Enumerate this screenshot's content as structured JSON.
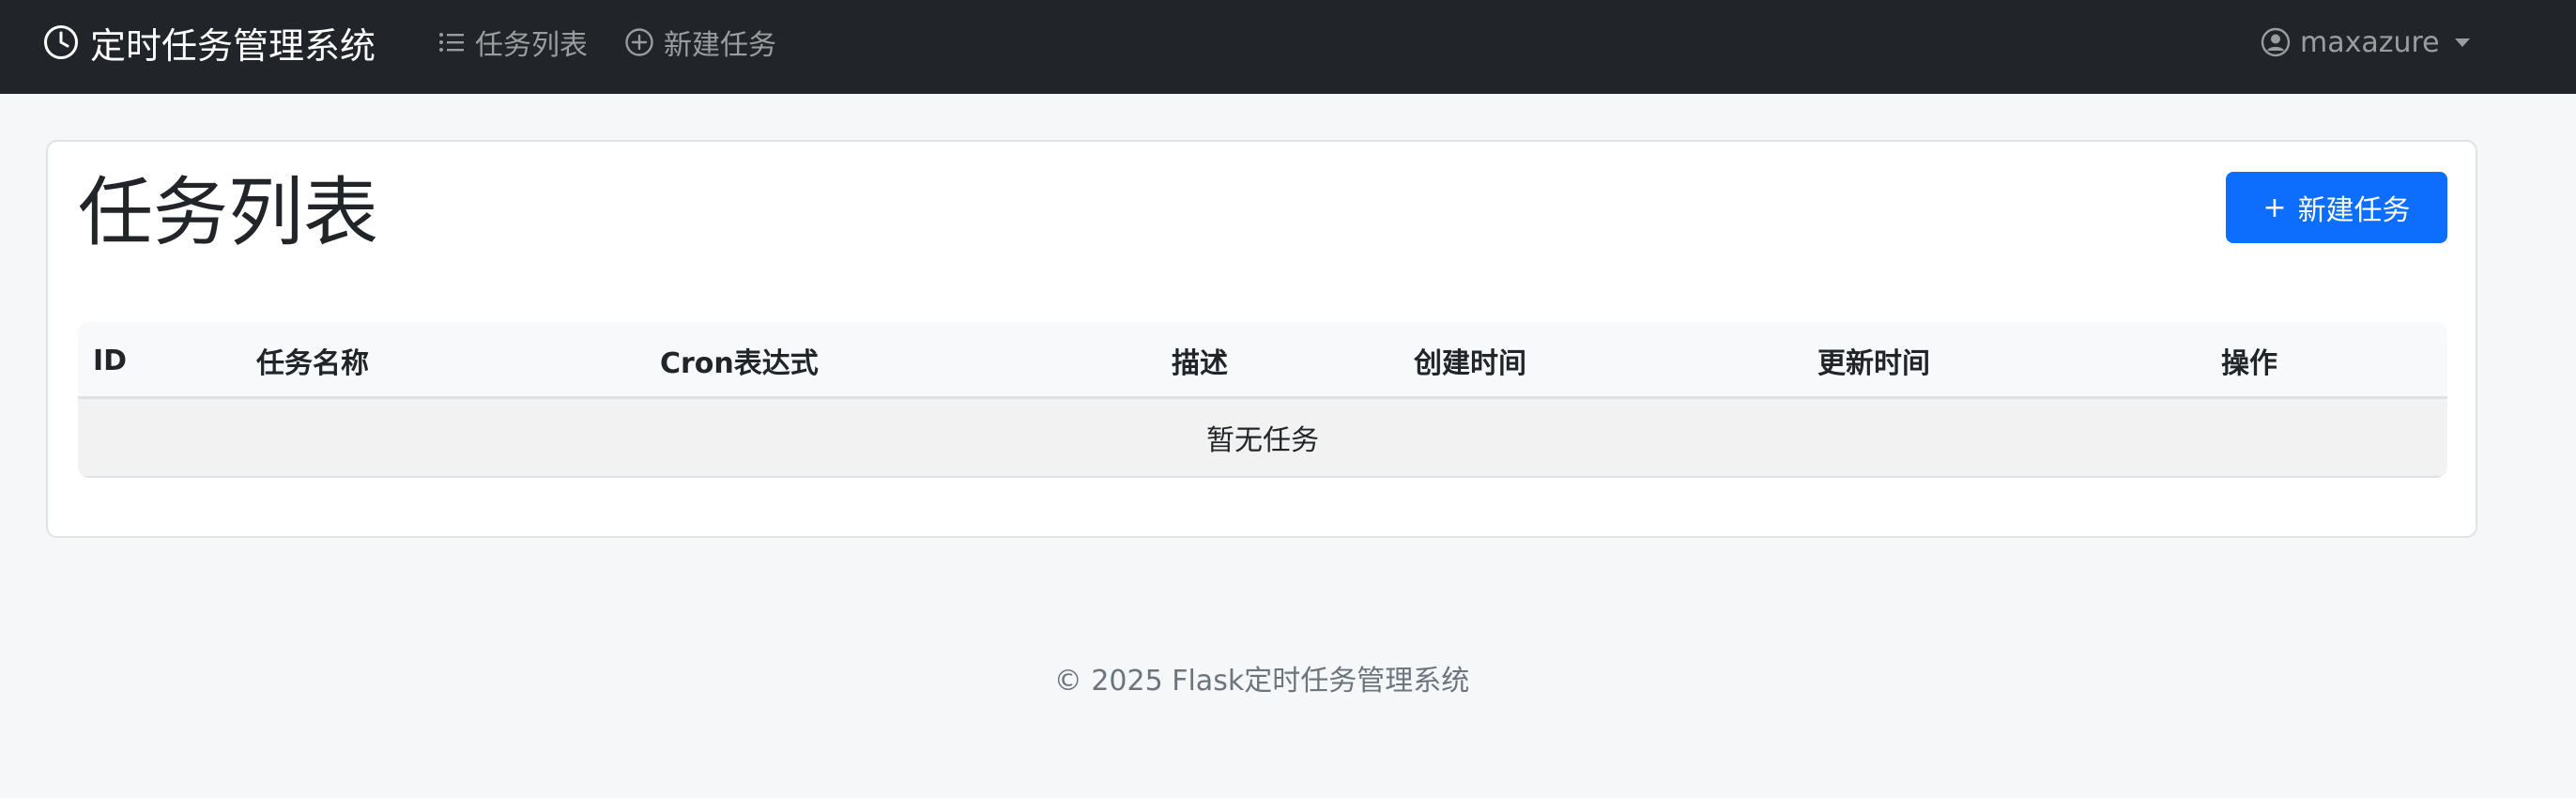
{
  "navbar": {
    "brand": "定时任务管理系统",
    "links": [
      {
        "label": "任务列表",
        "icon": "list-icon"
      },
      {
        "label": "新建任务",
        "icon": "plus-circle-icon"
      }
    ],
    "user": {
      "name": "maxazure",
      "icon": "user-circle-icon"
    }
  },
  "main": {
    "title": "任务列表",
    "new_button": {
      "icon": "plus-icon",
      "label": "新建任务"
    },
    "table": {
      "columns": [
        "ID",
        "任务名称",
        "Cron表达式",
        "描述",
        "创建时间",
        "更新时间",
        "操作"
      ],
      "empty_message": "暂无任务"
    }
  },
  "footer": {
    "text": "© 2025 Flask定时任务管理系统"
  },
  "colors": {
    "navbar_bg": "#212529",
    "primary": "#0d6efd",
    "page_bg": "#f6f7f9"
  }
}
